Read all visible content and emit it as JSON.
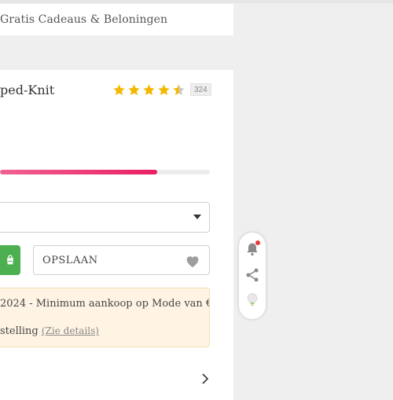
{
  "promo": {
    "text": "Gratis Cadeaus & Beloningen"
  },
  "product": {
    "title_fragment": "ped-Knit",
    "rating": {
      "stars": 4.5,
      "count": "324"
    },
    "progress_fraction": 0.75
  },
  "actions": {
    "save_label": "OPSLAAN"
  },
  "notice": {
    "line1": "2024 - Minimum aankoop op Mode van €",
    "line2_prefix": "stelling",
    "details_link": "(Zie details)"
  },
  "colors": {
    "accent_pink": "#e91e63",
    "cart_green": "#4caf50",
    "star_gold": "#f5b800",
    "notice_bg": "#fff4e3"
  },
  "icons": {
    "cart": "shopping-bag-icon",
    "save": "heart-icon",
    "select": "chevron-down-icon",
    "next": "chevron-right-icon",
    "float": [
      "bell-icon",
      "share-icon",
      "lightbulb-icon"
    ]
  }
}
